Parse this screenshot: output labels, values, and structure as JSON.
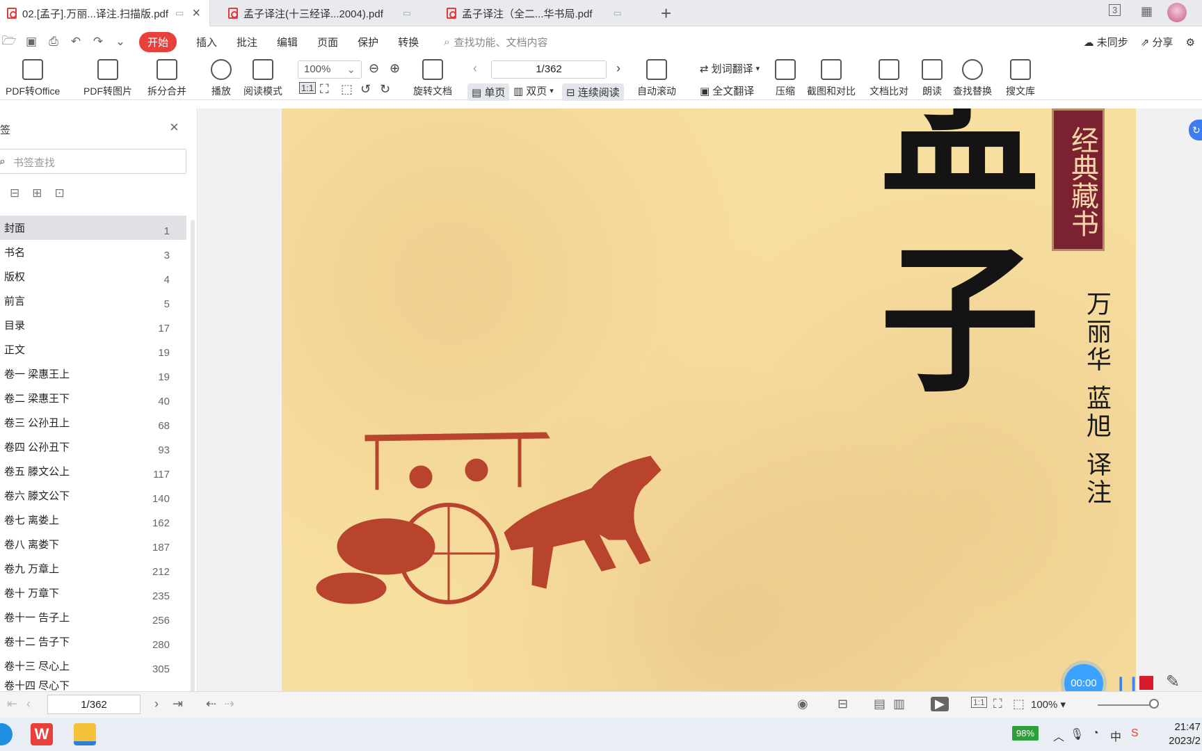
{
  "tabs": [
    {
      "label": "02.[孟子].万丽...译注.扫描版.pdf",
      "active": true
    },
    {
      "label": "孟子译注(十三经译...2004).pdf",
      "active": false
    },
    {
      "label": "孟子译注（全二...华书局.pdf",
      "active": false
    }
  ],
  "tabbar": {
    "add": "+",
    "pages_indicator": "3"
  },
  "menu": {
    "start": "开始",
    "items": [
      "插入",
      "批注",
      "编辑",
      "页面",
      "保护",
      "转换"
    ],
    "search_placeholder": "查找功能、文档内容",
    "sync": "未同步",
    "share": "分享"
  },
  "toolbar": {
    "pdf_to_office": "PDF转Office",
    "pdf_to_image": "PDF转图片",
    "split_merge": "拆分合并",
    "play": "播放",
    "read_mode": "阅读模式",
    "zoom": "100%",
    "rotate": "旋转文档",
    "page_indicator": "1/362",
    "single_page": "单页",
    "double_page": "双页",
    "continuous": "连续阅读",
    "auto_scroll": "自动滚动",
    "word_translate": "划词翻译",
    "full_translate": "全文翻译",
    "compress": "压缩",
    "screenshot_compare": "截图和对比",
    "doc_compare": "文档比对",
    "read_aloud": "朗读",
    "find_replace": "查找替换",
    "doc_library": "搜文库"
  },
  "sidebar": {
    "title": "签",
    "search_placeholder": "书签查找",
    "items": [
      {
        "label": "封面",
        "page": "1"
      },
      {
        "label": "书名",
        "page": "3"
      },
      {
        "label": "版权",
        "page": "4"
      },
      {
        "label": "前言",
        "page": "5"
      },
      {
        "label": "目录",
        "page": "17"
      },
      {
        "label": "正文",
        "page": "19"
      },
      {
        "label": "卷一 梁惠王上",
        "page": "19"
      },
      {
        "label": "卷二 梁惠王下",
        "page": "40"
      },
      {
        "label": "卷三 公孙丑上",
        "page": "68"
      },
      {
        "label": "卷四 公孙丑下",
        "page": "93"
      },
      {
        "label": "卷五 滕文公上",
        "page": "117"
      },
      {
        "label": "卷六 滕文公下",
        "page": "140"
      },
      {
        "label": "卷七 离娄上",
        "page": "162"
      },
      {
        "label": "卷八 离娄下",
        "page": "187"
      },
      {
        "label": "卷九 万章上",
        "page": "212"
      },
      {
        "label": "卷十 万章下",
        "page": "235"
      },
      {
        "label": "卷十一 告子上",
        "page": "256"
      },
      {
        "label": "卷十二 告子下",
        "page": "280"
      },
      {
        "label": "卷十三 尽心上",
        "page": "305"
      },
      {
        "label": "卷十四 尽心下",
        "page": ""
      }
    ]
  },
  "document": {
    "title_chars": [
      "孟",
      "子"
    ],
    "series_label": "经典藏书",
    "authors": "万丽华 蓝旭 译注"
  },
  "recorder": {
    "time": "00:00"
  },
  "bottombar": {
    "page": "1/362",
    "zoom": "100%"
  },
  "taskbar": {
    "battery": "98%",
    "ime": "中",
    "time": "21:47",
    "date": "2023/2"
  },
  "colors": {
    "accent": "#e8413b",
    "page_bg": "#f7dfa0",
    "banner": "#7a2230",
    "recorder": "#3ba3ff"
  }
}
